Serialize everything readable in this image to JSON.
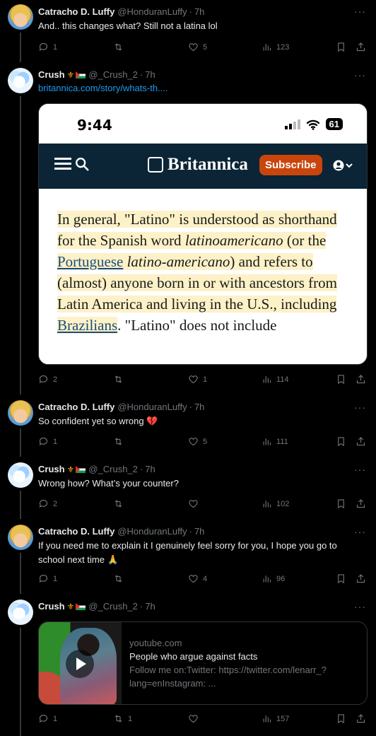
{
  "tweets": [
    {
      "name": "Catracho D. Luffy",
      "handle": "@HonduranLuffy",
      "time": "7h",
      "text": "And.. this changes what? Still not a latina lol",
      "replies": "1",
      "retweets": "",
      "likes": "5",
      "views": "123"
    },
    {
      "name": "Crush",
      "handle": "@_Crush_2",
      "time": "7h",
      "link": "britannica.com/story/whats-th....",
      "replies": "2",
      "retweets": "",
      "likes": "1",
      "views": "114"
    },
    {
      "name": "Catracho D. Luffy",
      "handle": "@HonduranLuffy",
      "time": "7h",
      "text": "So confident yet so wrong 💔",
      "replies": "1",
      "retweets": "",
      "likes": "5",
      "views": "111"
    },
    {
      "name": "Crush",
      "handle": "@_Crush_2",
      "time": "7h",
      "text": "Wrong how? What’s your counter?",
      "replies": "2",
      "retweets": "",
      "likes": "",
      "views": "102"
    },
    {
      "name": "Catracho D. Luffy",
      "handle": "@HonduranLuffy",
      "time": "7h",
      "text": "If you need me to explain it I genuinely feel sorry for you, I hope you go to school next time 🙏",
      "replies": "1",
      "retweets": "",
      "likes": "4",
      "views": "96"
    },
    {
      "name": "Crush",
      "handle": "@_Crush_2",
      "time": "7h",
      "replies": "1",
      "retweets": "1",
      "likes": "",
      "views": "157"
    }
  ],
  "britannica": {
    "clock": "9:44",
    "battery": "61",
    "logo": "Britannica",
    "subscribe": "Subscribe",
    "p1": "In general, \"Latino\" is understood as shorthand for the Spanish word ",
    "p2": "latinoamericano",
    "p3": " (or the ",
    "p4": "Portuguese",
    "p5": " ",
    "p6": "latino-americano",
    "p7": ") and refers to (almost) anyone born in or with ancestors from Latin America and living in the U.S., including ",
    "p8": "Brazilians",
    "p9": ". \"Latino\" does not include"
  },
  "youtube": {
    "domain": "youtube.com",
    "title": "People who argue against facts",
    "desc": "Follow me on:Twitter: https://twitter.com/lenarr_?lang=enInstagram: ..."
  },
  "colors": {
    "accent": "#1d9bf0",
    "muted": "#71767b",
    "bg": "#000000",
    "brit_navy": "#0b2536",
    "brit_subscribe": "#c9450c",
    "highlight": "#fdf1c7"
  }
}
